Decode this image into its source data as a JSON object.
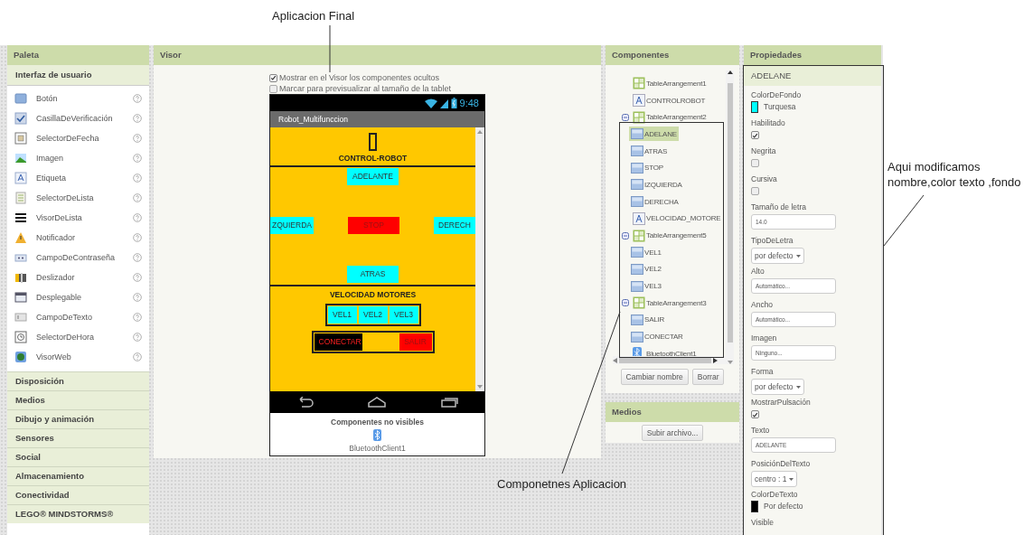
{
  "annotations": [
    {
      "text": "Aplicacion Final"
    },
    {
      "text": "Componetnes Aplicacion"
    },
    {
      "text": "Aqui modificamos nombre,color texto ,fondo"
    }
  ],
  "palette": {
    "title": "Paleta",
    "open_group": "Interfaz de usuario",
    "items": [
      "Botón",
      "CasillaDeVerificación",
      "SelectorDeFecha",
      "Imagen",
      "Etiqueta",
      "SelectorDeLista",
      "VisorDeLista",
      "Notificador",
      "CampoDeContraseña",
      "Deslizador",
      "Desplegable",
      "CampoDeTexto",
      "SelectorDeHora",
      "VisorWeb"
    ],
    "groups": [
      "Disposición",
      "Medios",
      "Dibujo y animación",
      "Sensores",
      "Social",
      "Almacenamiento",
      "Conectividad",
      "LEGO® MINDSTORMS®"
    ]
  },
  "viewer": {
    "title": "Visor",
    "options": [
      {
        "label": "Mostrar en el Visor los componentes ocultos",
        "checked": true
      },
      {
        "label": "Marcar para previsualizar al tamaño de la tablet",
        "checked": false
      }
    ],
    "phone": {
      "time": "9:48",
      "app_title": "Robot_Multifunccion",
      "sections": [
        {
          "kind": "header",
          "label": "CONTROL-ROBOT"
        },
        {
          "kind": "dpad",
          "buttons": [
            {
              "label": "ADELANTE",
              "color": "#00ffff"
            },
            {
              "label": "ZQUIERDA",
              "color": "#00ffff"
            },
            {
              "label": "STOP",
              "color": "#ff0000"
            },
            {
              "label": "DERECH",
              "color": "#00ffff"
            },
            {
              "label": "ATRAS",
              "color": "#00ffff"
            }
          ]
        },
        {
          "kind": "speed",
          "label": "VELOCIDAD MOTORES",
          "rows": [
            [
              {
                "label": "VEL1",
                "color": "#00ffff"
              },
              {
                "label": "VEL2",
                "color": "#00ffff"
              },
              {
                "label": "VEL3",
                "color": "#00ffff"
              }
            ],
            [
              {
                "label": "CONECTAR",
                "color": "#000000"
              },
              {
                "label": "SALIR",
                "color": "#ff0000"
              }
            ]
          ]
        }
      ],
      "hidden_title": "Componentes no visibles",
      "hidden_items": [
        "BluetoothClient1"
      ]
    }
  },
  "components": {
    "title": "Componentes",
    "tree": [
      {
        "label": "TableArrangement1",
        "kind": "table",
        "selected": false
      },
      {
        "label": "CONTROLROBOT",
        "kind": "label",
        "selected": false
      },
      {
        "label": "TableArrangement2",
        "kind": "table",
        "selected": false,
        "expanded": true,
        "children": [
          {
            "label": "ADELANE",
            "kind": "button",
            "selected": true
          },
          {
            "label": "ATRAS",
            "kind": "button",
            "selected": false
          },
          {
            "label": "STOP",
            "kind": "button",
            "selected": false
          },
          {
            "label": "IZQUIERDA",
            "kind": "button",
            "selected": false
          },
          {
            "label": "DERECHA",
            "kind": "button",
            "selected": false
          }
        ]
      },
      {
        "label": "VELOCIDAD_MOTORE",
        "kind": "label",
        "selected": false
      },
      {
        "label": "TableArrangement5",
        "kind": "table",
        "selected": false,
        "expanded": true,
        "children": [
          {
            "label": "VEL1",
            "kind": "button",
            "selected": false
          },
          {
            "label": "VEL2",
            "kind": "button",
            "selected": false
          },
          {
            "label": "VEL3",
            "kind": "button",
            "selected": false
          }
        ]
      },
      {
        "label": "TableArrangement3",
        "kind": "table",
        "selected": false,
        "expanded": true,
        "children": [
          {
            "label": "SALIR",
            "kind": "button",
            "selected": false
          },
          {
            "label": "CONECTAR",
            "kind": "button",
            "selected": false
          }
        ]
      },
      {
        "label": "BluetoothClient1",
        "kind": "bluetooth",
        "selected": false
      }
    ],
    "buttons": [
      "Cambiar nombre",
      "Borrar"
    ]
  },
  "media": {
    "title": "Medios",
    "button": "Subir archivo..."
  },
  "properties": {
    "title": "Propiedades",
    "component": "ADELANE",
    "items": [
      {
        "kind": "color",
        "label": "ColorDeFondo",
        "value": "Turquesa",
        "color": "#00ffff"
      },
      {
        "kind": "checkbox",
        "label": "Habilitado",
        "checked": true
      },
      {
        "kind": "checkbox",
        "label": "Negrita",
        "checked": false
      },
      {
        "kind": "checkbox",
        "label": "Cursiva",
        "checked": false
      },
      {
        "kind": "text",
        "label": "Tamaño de letra",
        "value": "14.0"
      },
      {
        "kind": "dropdown",
        "label": "TipoDeLetra",
        "value": "por defecto"
      },
      {
        "kind": "text",
        "label": "Alto",
        "value": "Automático..."
      },
      {
        "kind": "text",
        "label": "Ancho",
        "value": "Automático..."
      },
      {
        "kind": "text",
        "label": "Imagen",
        "value": "Ninguno..."
      },
      {
        "kind": "dropdown",
        "label": "Forma",
        "value": "por defecto"
      },
      {
        "kind": "checkbox",
        "label": "MostrarPulsación",
        "checked": true
      },
      {
        "kind": "text",
        "label": "Texto",
        "value": "ADELANTE"
      },
      {
        "kind": "dropdown",
        "label": "PosiciónDelTexto",
        "value": "centro : 1"
      },
      {
        "kind": "color",
        "label": "ColorDeTexto",
        "value": "Por defecto",
        "color": "#000000"
      },
      {
        "kind": "label",
        "label": "Visible"
      }
    ]
  }
}
